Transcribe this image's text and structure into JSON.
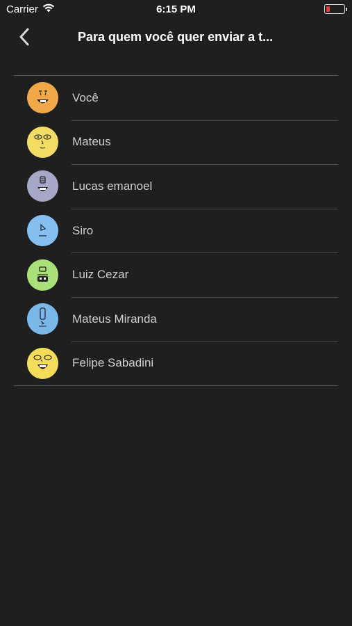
{
  "status_bar": {
    "carrier": "Carrier",
    "time": "6:15 PM",
    "battery_color": "#e53935"
  },
  "nav": {
    "back_icon": "chevron-left-icon",
    "title": "Para quem você quer enviar a t..."
  },
  "contacts": [
    {
      "name": "Você",
      "avatar_color": "#f0a848"
    },
    {
      "name": "Mateus",
      "avatar_color": "#f2dc66"
    },
    {
      "name": "Lucas emanoel",
      "avatar_color": "#a7a8c7"
    },
    {
      "name": "Siro",
      "avatar_color": "#84bff0"
    },
    {
      "name": "Luiz Cezar",
      "avatar_color": "#a9e07a"
    },
    {
      "name": "Mateus Miranda",
      "avatar_color": "#7ab8ea"
    },
    {
      "name": "Felipe Sabadini",
      "avatar_color": "#f2dc5a"
    }
  ]
}
